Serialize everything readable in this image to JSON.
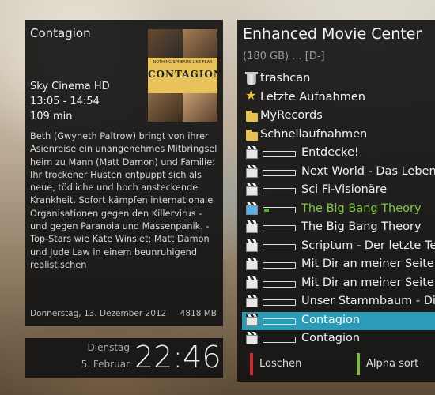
{
  "info": {
    "title": "Contagion",
    "poster": {
      "tagline": "NOTHING SPREADS LIKE FEAR",
      "title": "CONTAGION"
    },
    "channel": "Sky Cinema HD",
    "time": "13:05 - 14:54",
    "duration": "109 min",
    "description": "Beth (Gwyneth Paltrow) bringt von ihrer Asienreise ein unangenehmes Mitbringsel heim zu Mann (Matt Damon) und Familie: Ihr trockener Husten entpuppt sich als neue, tödliche und hoch ansteckende Krankheit. Sofort kämpfen internationale Organisationen gegen den Killervirus - und gegen Paranoia und Massenpanik. - Top-Stars wie Kate Winslet; Matt Damon und Jude Law in einem beunruhigend realistischen",
    "date": "Donnerstag, 13. Dezember 2012",
    "size": "4818 MB"
  },
  "clock": {
    "weekday": "Dienstag",
    "date": "5. Februar",
    "time": "22:46"
  },
  "emc": {
    "title": "Enhanced Movie Center",
    "subtitle": "(180 GB) ... [D-]",
    "dirs": [
      {
        "label": "trashcan",
        "icon": "trash-icon"
      },
      {
        "label": "Letzte Aufnahmen",
        "icon": "star-icon"
      },
      {
        "label": "MyRecords",
        "icon": "folder-icon"
      },
      {
        "label": "Schnellaufnahmen",
        "icon": "folder-icon"
      }
    ],
    "movies": [
      {
        "label": "Entdecke!",
        "progress": 0
      },
      {
        "label": "Next World - Das Leben der Zukunft",
        "progress": 0
      },
      {
        "label": "Sci Fi-Visionäre",
        "progress": 0
      },
      {
        "label": "The Big Bang Theory",
        "progress": 0.15
      },
      {
        "label": "The Big Bang Theory",
        "progress": 0
      },
      {
        "label": "Scriptum - Der letzte Tempelritter",
        "progress": 0
      },
      {
        "label": "Mit Dir an meiner Seite",
        "progress": 0
      },
      {
        "label": "Mit Dir an meiner Seite",
        "progress": 0
      },
      {
        "label": "Unser Stammbaum - Die Vorfahren",
        "progress": 0
      },
      {
        "label": "Contagion",
        "progress": 0
      },
      {
        "label": "Contagion",
        "progress": 0
      }
    ],
    "buttons": {
      "red": "Loschen",
      "green": "Alpha sort"
    },
    "colors": {
      "selection": "#2a9cb8",
      "inprogress": "#7ec844",
      "red": "#d42a2a",
      "green": "#7fbb3c"
    }
  }
}
